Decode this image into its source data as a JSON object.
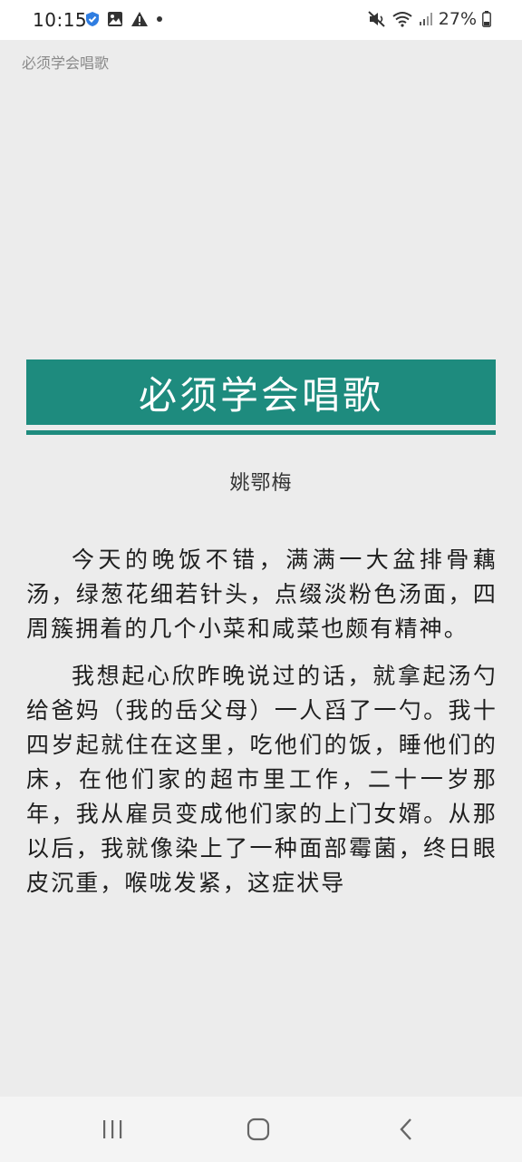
{
  "status_bar": {
    "time": "10:15",
    "battery_text": "27%",
    "left_icons": [
      "shield-check-icon",
      "image-icon",
      "warning-icon",
      "dot-icon"
    ],
    "right_icons": [
      "mute-icon",
      "wifi-icon",
      "signal-icon",
      "battery-icon"
    ]
  },
  "header": {
    "book_title": "必须学会唱歌"
  },
  "chapter": {
    "title": "必须学会唱歌",
    "author": "姚鄂梅",
    "accent_color": "#1e8b7e"
  },
  "content": {
    "paragraphs": [
      "今天的晚饭不错，满满一大盆排骨藕汤，绿葱花细若针头，点缀淡粉色汤面，四周簇拥着的几个小菜和咸菜也颇有精神。",
      "我想起心欣昨晚说过的话，就拿起汤勺给爸妈（我的岳父母）一人舀了一勺。我十四岁起就住在这里，吃他们的饭，睡他们的床，在他们家的超市里工作，二十一岁那年，我从雇员变成他们家的上门女婿。从那以后，我就像染上了一种面部霉菌，终日眼皮沉重，喉咙发紧，这症状导"
    ]
  },
  "nav_bar": {
    "buttons": [
      "recent-apps-icon",
      "home-icon",
      "back-icon"
    ]
  }
}
